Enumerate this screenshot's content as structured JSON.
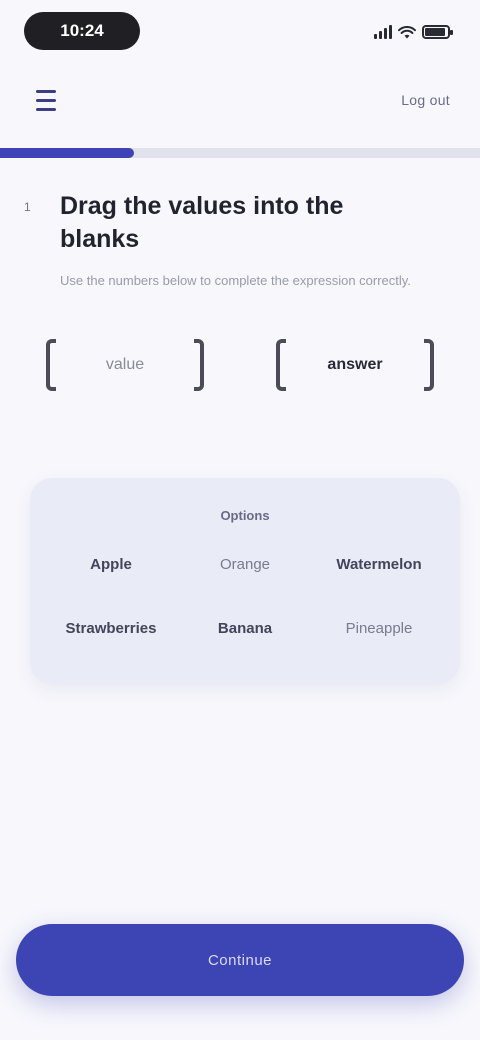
{
  "status": {
    "time": "10:24"
  },
  "header": {
    "logout_label": "Log out"
  },
  "progress": {
    "value": 0.28,
    "color": "#3e44b6"
  },
  "question": {
    "number": "1",
    "title": "Drag the values into the blanks",
    "hint": "Use the numbers below to complete the expression correctly."
  },
  "inputs": [
    {
      "placeholder": "value",
      "value": ""
    },
    {
      "placeholder": "",
      "value": "answer"
    }
  ],
  "options_card": {
    "title": "Options",
    "items": [
      {
        "label": "Apple",
        "style": "bold"
      },
      {
        "label": "Orange",
        "style": "light"
      },
      {
        "label": "Watermelon",
        "style": "bold"
      },
      {
        "label": "Strawberries",
        "style": "bold"
      },
      {
        "label": "Banana",
        "style": "bold"
      },
      {
        "label": "Pineapple",
        "style": "light"
      }
    ]
  },
  "footer": {
    "continue_label": "Continue",
    "button_color": "#3d44b3"
  },
  "icons": {
    "menu": "hamburger-icon",
    "signal": "signal-icon",
    "wifi": "wifi-icon",
    "battery": "battery-icon"
  }
}
